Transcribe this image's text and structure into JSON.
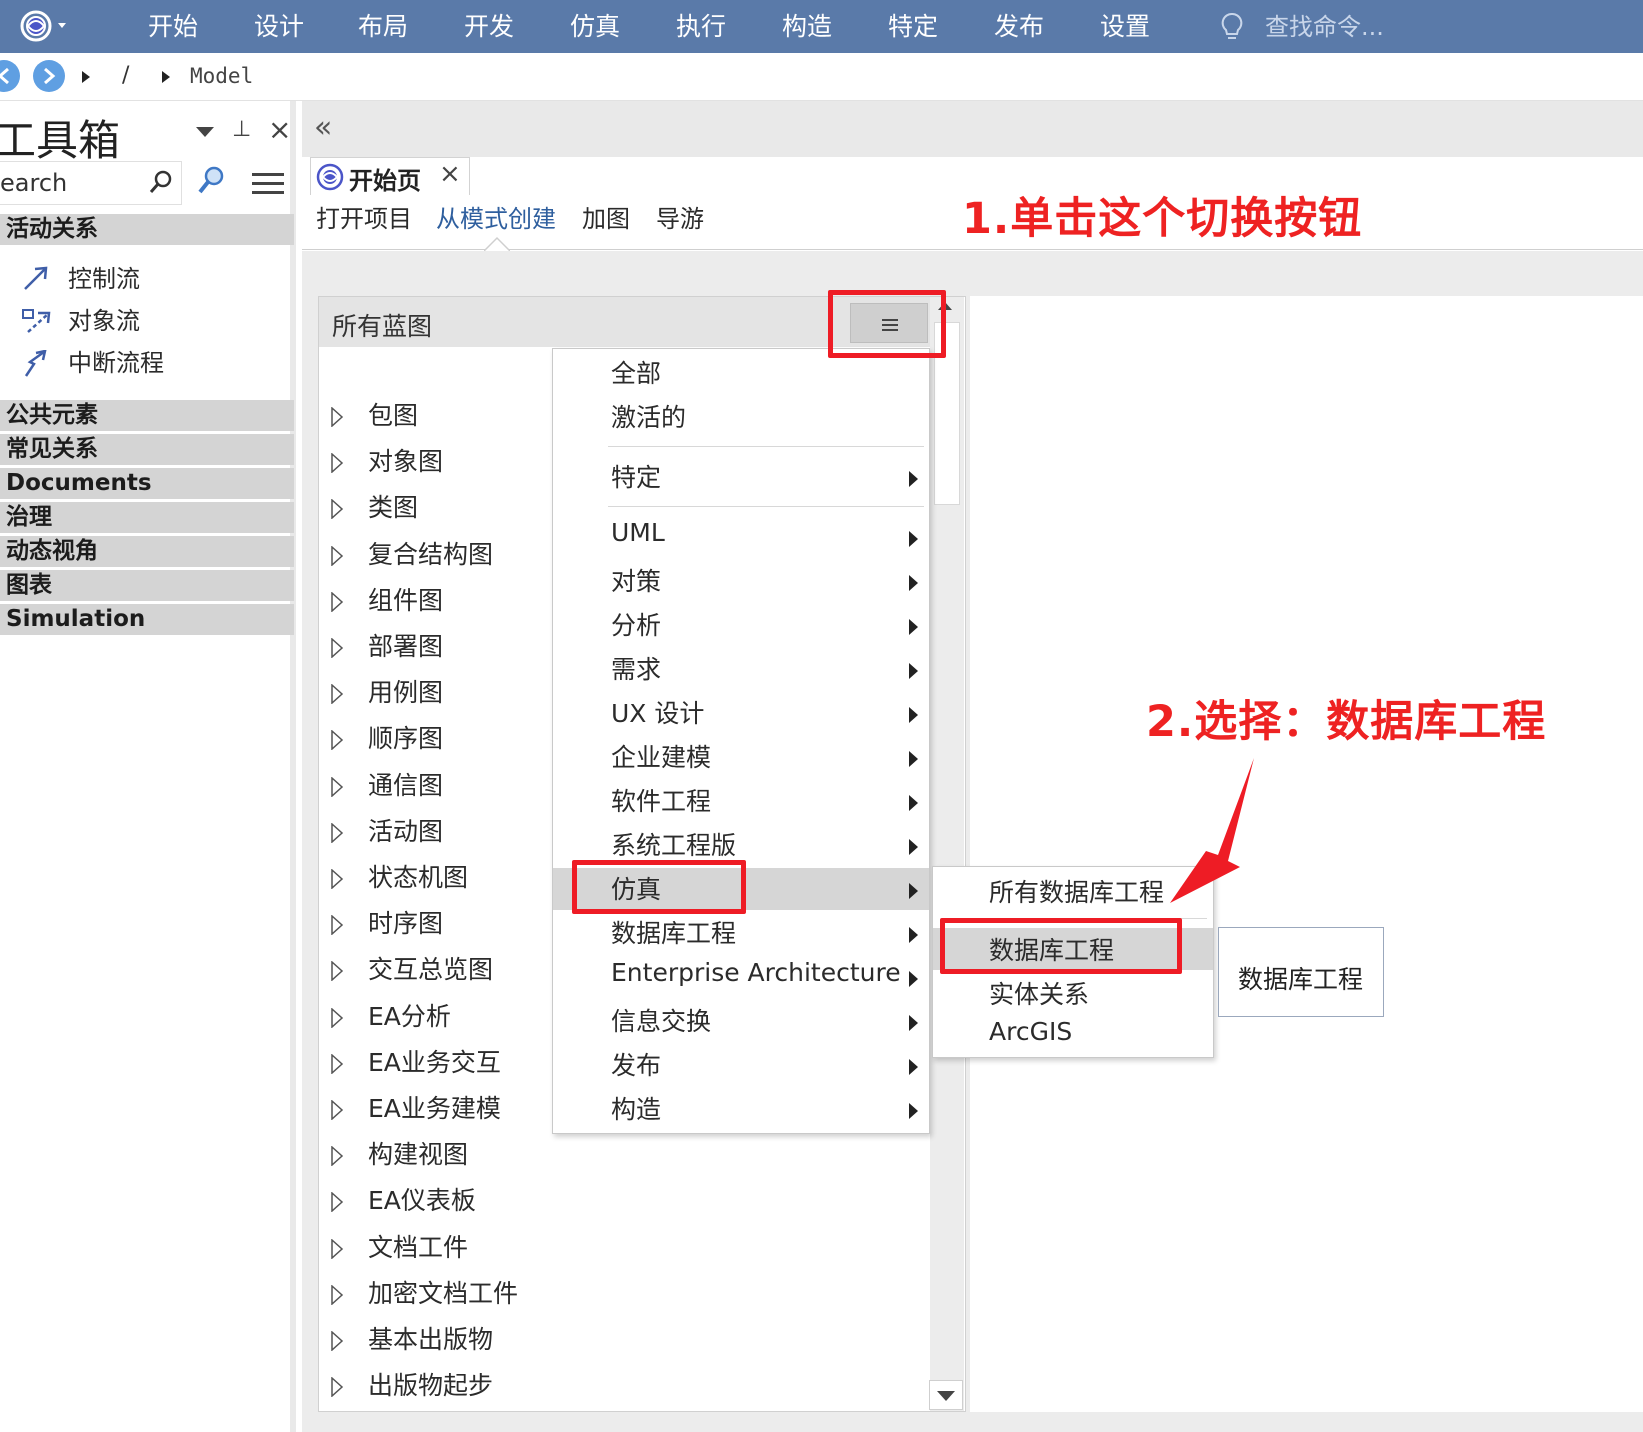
{
  "menubar": {
    "items": [
      "开始",
      "设计",
      "布局",
      "开发",
      "仿真",
      "执行",
      "构造",
      "特定",
      "发布",
      "设置"
    ],
    "search_placeholder": "查找命令..."
  },
  "breadcrumb": {
    "separator": "/",
    "model": "Model"
  },
  "toolbox": {
    "title": "工具箱",
    "search_value": "earch",
    "sections_top": {
      "title": "活动关系"
    },
    "items": [
      {
        "label": "控制流",
        "icon": "control-flow-icon"
      },
      {
        "label": "对象流",
        "icon": "object-flow-icon"
      },
      {
        "label": "中断流程",
        "icon": "interrupt-flow-icon"
      }
    ],
    "sections": [
      "公共元素",
      "常见关系",
      "Documents",
      "治理",
      "动态视角",
      "图表",
      "Simulation"
    ]
  },
  "doc_tab": {
    "label": "开始页"
  },
  "subtabs": {
    "items": [
      "打开项目",
      "从模式创建",
      "加图",
      "导游"
    ],
    "active_index": 1
  },
  "annotations": {
    "step1": "1.单击这个切换按钮",
    "step2": "2.选择：数据库工程"
  },
  "blueprint": {
    "title": "所有蓝图",
    "items": [
      "包图",
      "对象图",
      "类图",
      "复合结构图",
      "组件图",
      "部署图",
      "用例图",
      "顺序图",
      "通信图",
      "活动图",
      "状态机图",
      "时序图",
      "交互总览图",
      "EA分析",
      "EA业务交互",
      "EA业务建模",
      "构建视图",
      "EA仪表板",
      "文档工件",
      "加密文档工件",
      "基本出版物",
      "出版物起步"
    ]
  },
  "menu": {
    "top": [
      "全部",
      "激活的"
    ],
    "special": "特定",
    "groups": [
      "UML",
      "对策",
      "分析",
      "需求",
      "UX 设计",
      "企业建模",
      "软件工程",
      "系统工程版",
      "仿真",
      "数据库工程",
      "Enterprise Architecture",
      "信息交换",
      "发布",
      "构造"
    ],
    "highlighted": "仿真"
  },
  "submenu": {
    "all": "所有数据库工程",
    "items": [
      "数据库工程",
      "实体关系",
      "ArcGIS"
    ],
    "highlighted": "数据库工程"
  },
  "tooltip": {
    "text": "数据库工程"
  },
  "colors": {
    "menubar": "#5a7aa9",
    "annotation_red": "#ee2222",
    "highlight_gray": "#d6d6d6",
    "section_gray": "#d4d4d4",
    "active_tab_blue": "#2f5f9e"
  }
}
